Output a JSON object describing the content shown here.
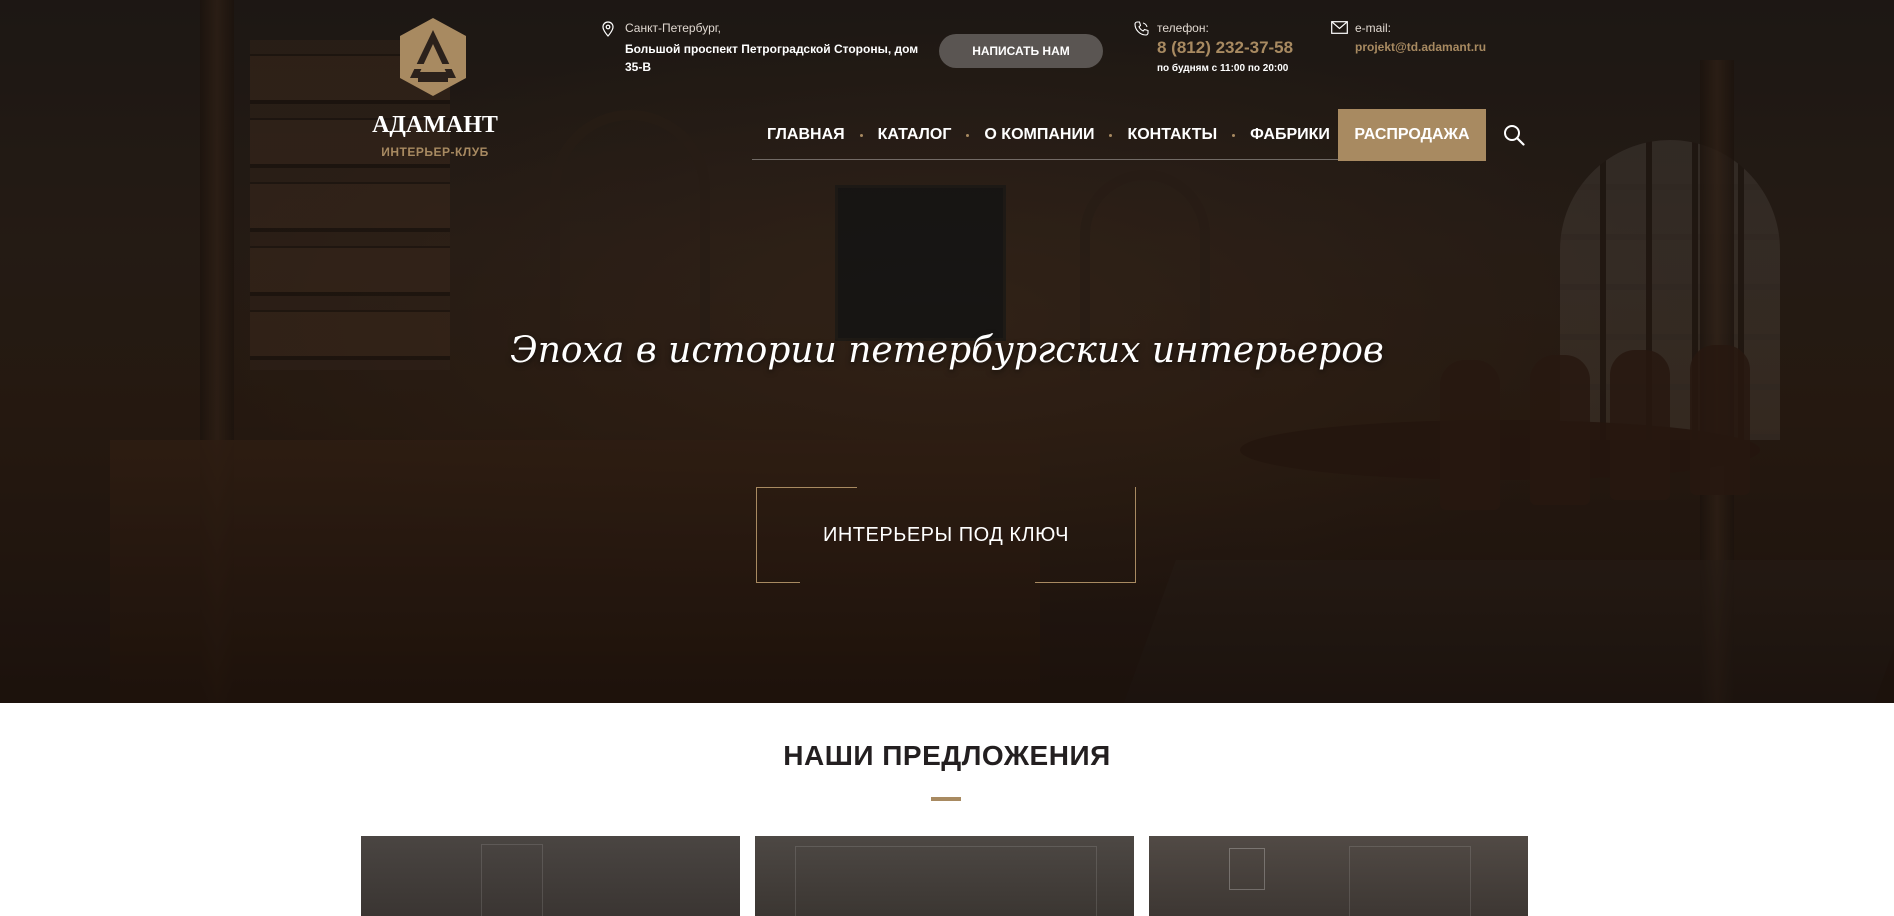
{
  "brand": {
    "name": "АДАМАНТ",
    "subtitle": "ИНТЕРЬЕР-КЛУБ"
  },
  "header": {
    "address": {
      "city": "Санкт-Петербург,",
      "street": "Большой проспект Петроградской Стороны, дом 35-В"
    },
    "write_button": "НАПИСАТЬ НАМ",
    "phone": {
      "label": "телефон:",
      "number": "8 (812) 232-37-58",
      "hours": "по будням с 11:00 по 20:00"
    },
    "email": {
      "label": "e-mail:",
      "address": "projekt@td.adamant.ru"
    }
  },
  "nav": {
    "items": [
      "ГЛАВНАЯ",
      "КАТАЛОГ",
      "О КОМПАНИИ",
      "КОНТАКТЫ",
      "ФАБРИКИ"
    ],
    "sale": "РАСПРОДАЖА"
  },
  "hero": {
    "slogan": "Эпоха в истории петербургских интерьеров",
    "cta": "ИНТЕРЬЕРЫ ПОД КЛЮЧ"
  },
  "offers": {
    "title": "НАШИ ПРЕДЛОЖЕНИЯ"
  },
  "colors": {
    "accent": "#a88a61",
    "heading": "#231f20"
  }
}
